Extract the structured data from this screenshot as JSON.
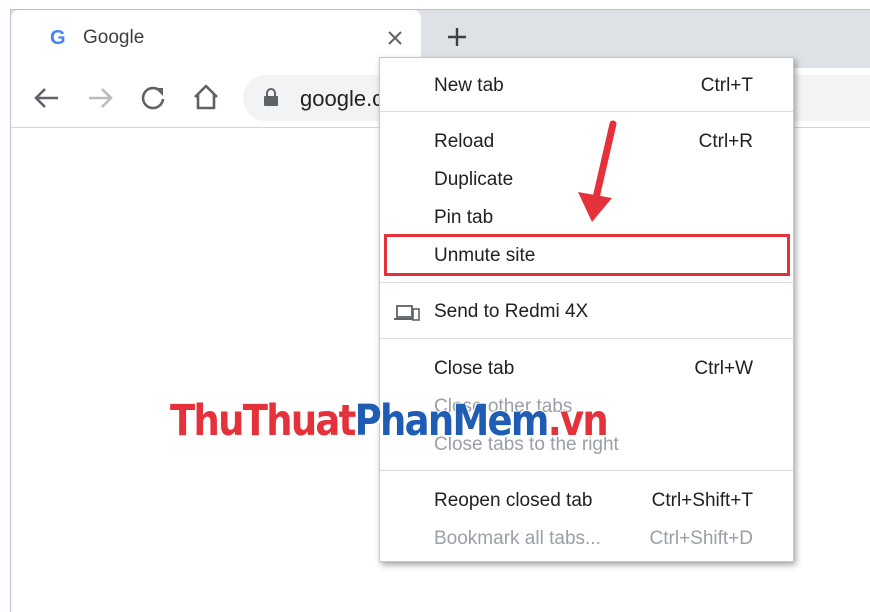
{
  "tab": {
    "title": "Google",
    "favicon": "google-g-icon"
  },
  "toolbar": {
    "omnibox_text": "google.c"
  },
  "menu": {
    "items": [
      {
        "label": "New tab",
        "shortcut": "Ctrl+T"
      },
      {
        "label": "Reload",
        "shortcut": "Ctrl+R"
      },
      {
        "label": "Duplicate",
        "shortcut": ""
      },
      {
        "label": "Pin tab",
        "shortcut": ""
      },
      {
        "label": "Unmute site",
        "shortcut": ""
      },
      {
        "label": "Send to Redmi 4X",
        "shortcut": ""
      },
      {
        "label": "Close tab",
        "shortcut": "Ctrl+W"
      },
      {
        "label": "Close other tabs",
        "shortcut": ""
      },
      {
        "label": "Close tabs to the right",
        "shortcut": ""
      },
      {
        "label": "Reopen closed tab",
        "shortcut": "Ctrl+Shift+T"
      },
      {
        "label": "Bookmark all tabs...",
        "shortcut": "Ctrl+Shift+D"
      }
    ]
  },
  "watermark": {
    "part1": "ThuThuat",
    "part2": "PhanMem",
    "part3": ".vn"
  },
  "colors": {
    "annotation_red": "#e5313a",
    "tabstrip": "#dee1e6",
    "disabled_text": "#9aa0a6"
  }
}
